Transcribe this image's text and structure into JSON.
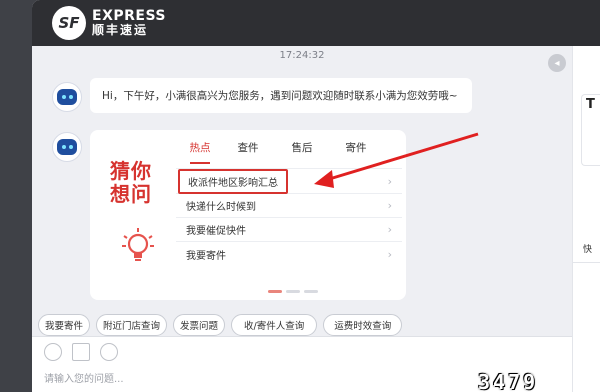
{
  "brand": {
    "mark": "SF",
    "name_en": "EXPRESS",
    "name_cn": "顺丰速运"
  },
  "chat": {
    "timestamp": "17:24:32",
    "greeting": "Hi，下午好，小满很高兴为您服务，遇到问题欢迎随时联系小满为您效劳哦~",
    "card": {
      "guess_line1": "猜你",
      "guess_line2": "想问",
      "tabs": [
        {
          "label": "热点",
          "active": true
        },
        {
          "label": "查件",
          "active": false
        },
        {
          "label": "售后",
          "active": false
        },
        {
          "label": "寄件",
          "active": false
        }
      ],
      "questions": [
        {
          "text": "收派件地区影响汇总",
          "highlighted": true
        },
        {
          "text": "快递什么时候到",
          "highlighted": false
        },
        {
          "text": "我要催促快件",
          "highlighted": false
        },
        {
          "text": "我要寄件",
          "highlighted": false
        }
      ],
      "pager": {
        "count": 3,
        "current": 1
      }
    }
  },
  "quick_actions": [
    "我要寄件",
    "附近门店查询",
    "发票问题",
    "收/寄件人查询",
    "运费时效查询"
  ],
  "composer": {
    "placeholder": "请输入您的问题...",
    "tools": [
      "emoji-icon",
      "image-icon",
      "check-icon"
    ]
  },
  "side_panel": {
    "line1": "T",
    "line2": "",
    "line3": "",
    "tab_text": "快"
  },
  "watermark": "3479",
  "colors": {
    "accent": "#d6332f",
    "topbar": "#2e2f33",
    "chat_bg": "#eeeff3"
  }
}
